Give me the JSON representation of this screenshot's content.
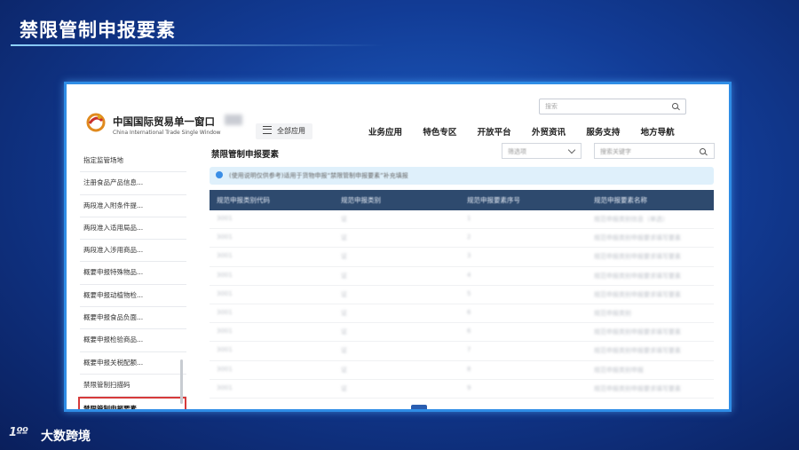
{
  "slide": {
    "title": "禁限管制申报要素",
    "brand_icon": "1ºº",
    "brand_name": "大数跨境"
  },
  "header": {
    "logo_cn": "中国国际贸易单一窗口",
    "logo_en": "China International Trade Single Window",
    "all_apps": "全部应用",
    "search_placeholder": "搜索",
    "nav": [
      "业务应用",
      "特色专区",
      "开放平台",
      "外贸资讯",
      "服务支持",
      "地方导航"
    ]
  },
  "sidebar": {
    "items": [
      "指定监管场地",
      "注册食品产品信息...",
      "两段准入附条件提...",
      "两段准入适用局品...",
      "两段准入涉用商品...",
      "概要申报特殊物品...",
      "概要申报动植物检...",
      "概要申报食品负面...",
      "概要申报检验商品...",
      "概要申报关税配额...",
      "禁限管制扫描码",
      "禁限管制申报要素"
    ]
  },
  "main": {
    "title": "禁限管制申报要素",
    "filter_placeholder": "筛选项",
    "search_placeholder": "搜索关键字",
    "notice": "(使用说明仅供参考)适用于货物申报“禁限管制申报要素”补充填报",
    "table": {
      "headers": [
        "规范申报类别代码",
        "规范申报类别",
        "规范申报要素序号",
        "规范申报要素名称"
      ],
      "rows": [
        [
          "3001",
          "证",
          "1",
          "规范申报类别信息（单选）"
        ],
        [
          "3001",
          "证",
          "2",
          "规范申报类别申报要求填写要素"
        ],
        [
          "3001",
          "证",
          "3",
          "规范申报类别申报要求填写要素"
        ],
        [
          "3001",
          "证",
          "4",
          "规范申报类别申报要求填写要素"
        ],
        [
          "3001",
          "证",
          "5",
          "规范申报类别申报要求填写要素"
        ],
        [
          "3001",
          "证",
          "6",
          "规范申报类别"
        ],
        [
          "3001",
          "证",
          "6",
          "规范申报类别申报要求填写要素"
        ],
        [
          "3001",
          "证",
          "7",
          "规范申报类别申报要求填写要素"
        ],
        [
          "3001",
          "证",
          "8",
          "规范申报类别申报"
        ],
        [
          "3001",
          "证",
          "9",
          "规范申报类别申报要求填写要素"
        ]
      ]
    }
  },
  "colors": {
    "accent": "#2e4a6e",
    "frame": "#2f8de6",
    "highlight": "#d63a3a",
    "notice_bg": "#dff0fb"
  }
}
